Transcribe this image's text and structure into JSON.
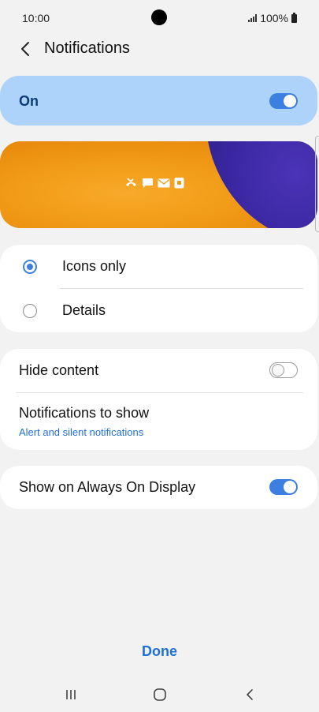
{
  "status_bar": {
    "time": "10:00",
    "battery": "100%"
  },
  "header": {
    "title": "Notifications"
  },
  "master_toggle": {
    "label": "On",
    "state": "on"
  },
  "style_options": {
    "items": [
      {
        "label": "Icons only",
        "selected": true
      },
      {
        "label": "Details",
        "selected": false
      }
    ]
  },
  "settings": {
    "hide_content": {
      "label": "Hide content",
      "state": "off"
    },
    "notifications_to_show": {
      "label": "Notifications to show",
      "value": "Alert and silent notifications"
    }
  },
  "aod": {
    "label": "Show on Always On Display",
    "state": "on"
  },
  "footer": {
    "done_label": "Done"
  },
  "colors": {
    "accent": "#3d7fe0",
    "link": "#1f6fd6",
    "master_bg": "#add3fb"
  }
}
